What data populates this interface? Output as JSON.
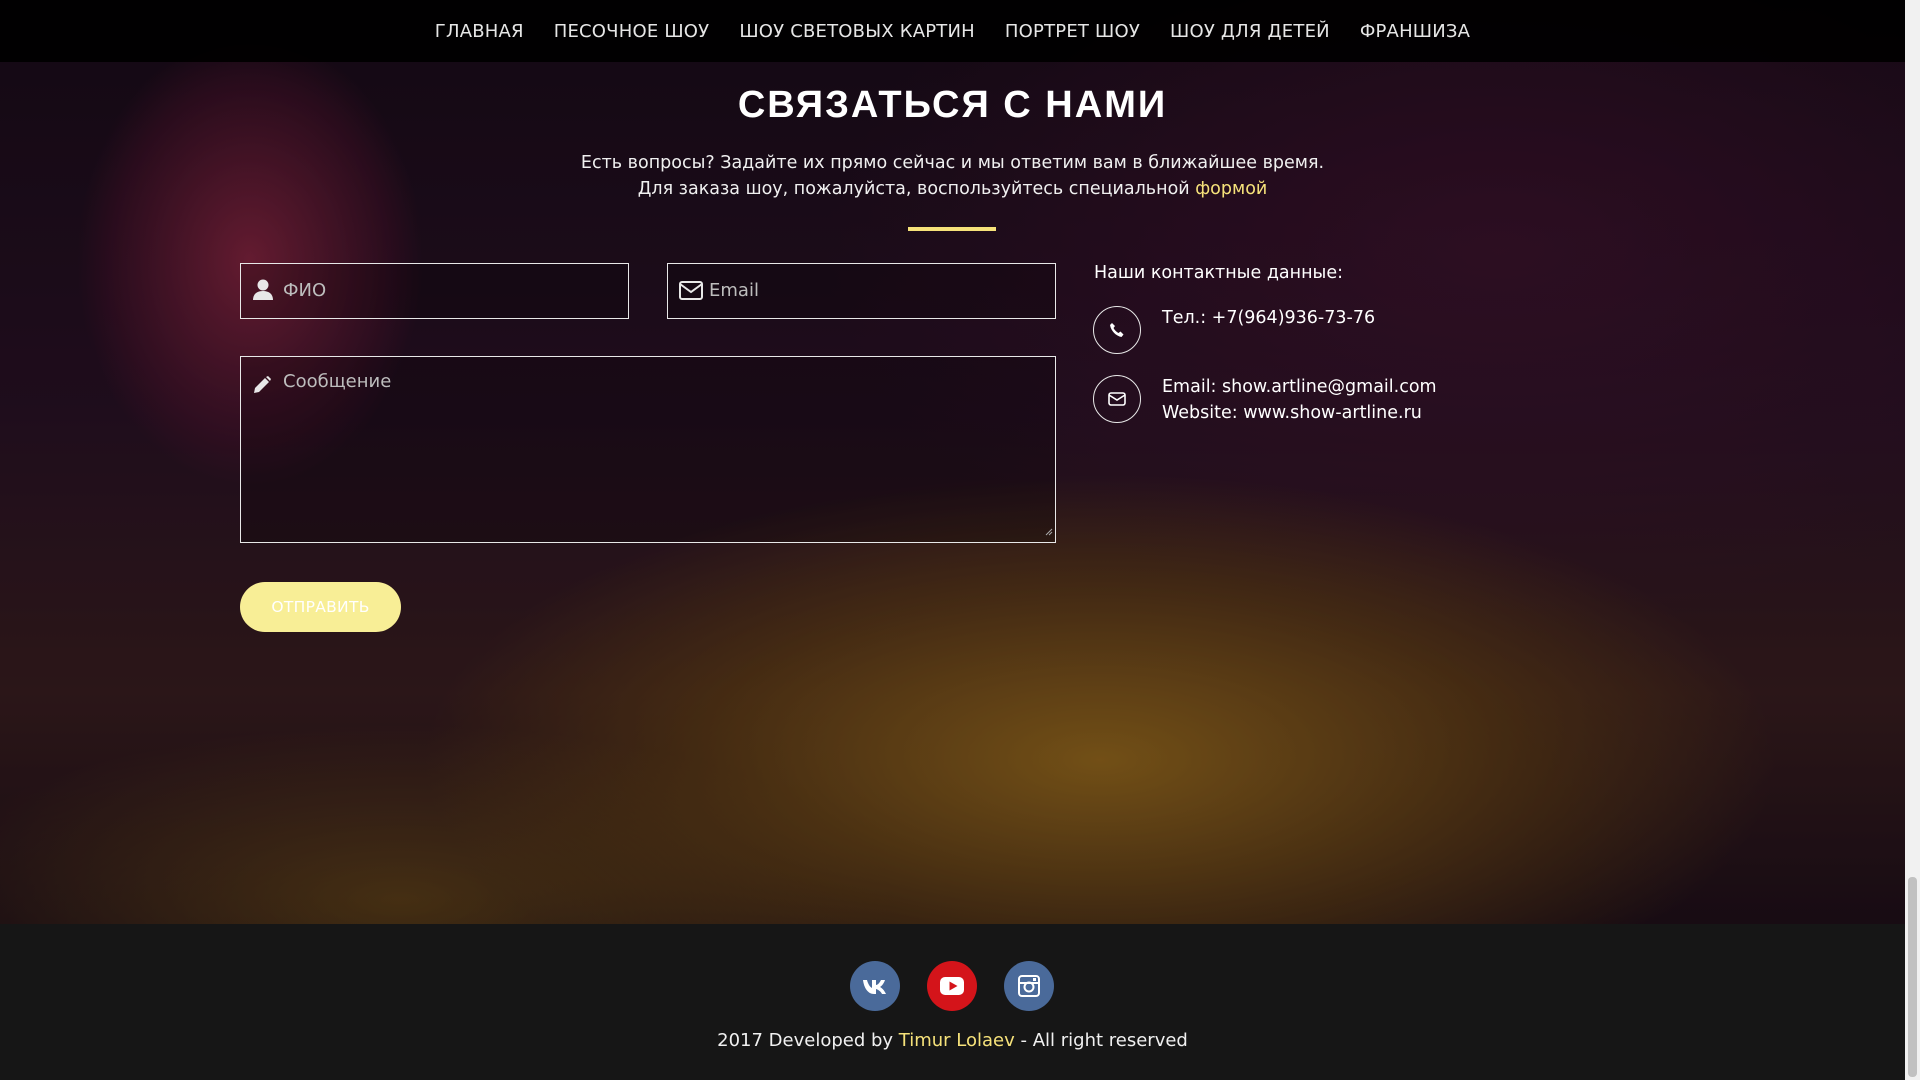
{
  "nav": {
    "items": [
      "ГЛАВНАЯ",
      "ПЕСОЧНОЕ ШОУ",
      "ШОУ СВЕТОВЫХ КАРТИН",
      "ПОРТРЕТ ШОУ",
      "ШОУ ДЛЯ ДЕТЕЙ",
      "ФРАНШИЗА"
    ]
  },
  "contact": {
    "title": "СВЯЗАТЬСЯ С НАМИ",
    "line1": "Есть вопросы? Задайте их прямо сейчас и мы ответим вам в ближайшее время.",
    "line2_prefix": "Для заказа шоу, пожалуйста, воспользуйтесь специальной ",
    "line2_link": "формой"
  },
  "form": {
    "name_placeholder": "ФИО",
    "email_placeholder": "Email",
    "message_placeholder": "Сообщение",
    "submit_label": "ОТПРАВИТЬ"
  },
  "details": {
    "title": "Наши контактные данные:",
    "phone": "Тел.: +7(964)936-73-76",
    "email": "Email: show.artline@gmail.com",
    "website": "Website: www.show-artline.ru"
  },
  "footer": {
    "prefix": "2017 Developed by ",
    "author": "Timur Lolaev",
    "suffix": " - All right reserved",
    "social": [
      "vk-icon",
      "youtube-icon",
      "instagram-icon"
    ]
  },
  "colors": {
    "accent": "#f6e27a",
    "vk": "#4a6a9a",
    "youtube": "#d4141a",
    "instagram": "#4a6a9a"
  }
}
